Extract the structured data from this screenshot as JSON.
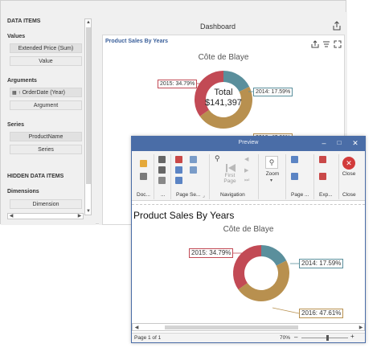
{
  "designer": {
    "data_items_title": "DATA ITEMS",
    "values_title": "Values",
    "values_item": "Extended Price (Sum)",
    "values_button": "Value",
    "arguments_title": "Arguments",
    "arguments_item": "OrderDate (Year)",
    "arguments_button": "Argument",
    "series_title": "Series",
    "series_item": "ProductName",
    "series_button": "Series",
    "hidden_title": "HIDDEN DATA ITEMS",
    "dimensions_title": "Dimensions",
    "dimension_button": "Dimension",
    "dashboard_title": "Dashboard",
    "card_title": "Product Sales By Years",
    "card_subtitle": "Côte de Blaye",
    "center_label_1": "Total",
    "center_label_2": "$141,397",
    "labels": {
      "red": "2015: 34.79%",
      "teal": "2014: 17.59%",
      "gold": "2016: 47.61%"
    }
  },
  "preview": {
    "window_title": "Preview",
    "groups": {
      "document": "Doc...",
      "print": "...",
      "page_setup": "Page Se...",
      "navigation": "Navigation",
      "zoom": "",
      "page_background": "Page ...",
      "export": "Exp...",
      "close": "Close"
    },
    "buttons": {
      "first_page": "First\nPage",
      "zoom": "Zoom",
      "close": "Close"
    },
    "report_title": "Product Sales By Years",
    "report_subtitle": "Côte de Blaye",
    "labels": {
      "red": "2015: 34.79%",
      "teal": "2014: 17.59%",
      "gold": "2016: 47.61%"
    },
    "status_page": "Page 1 of 1",
    "zoom_level": "70%",
    "zoom_fraction": 0.7
  },
  "chart_data": {
    "type": "pie",
    "style": "donut",
    "title": "Product Sales By Years",
    "subtitle": "Côte de Blaye",
    "total": "$141,397",
    "slices": [
      {
        "label": "2014",
        "percent": 17.59,
        "color": "#5a8f9c"
      },
      {
        "label": "2015",
        "percent": 34.79,
        "color": "#c24a55"
      },
      {
        "label": "2016",
        "percent": 47.61,
        "color": "#b8904f"
      }
    ]
  },
  "colors": {
    "accent": "#4a6da7",
    "card_title": "#3a5f9a",
    "close_red": "#d23b3b"
  }
}
